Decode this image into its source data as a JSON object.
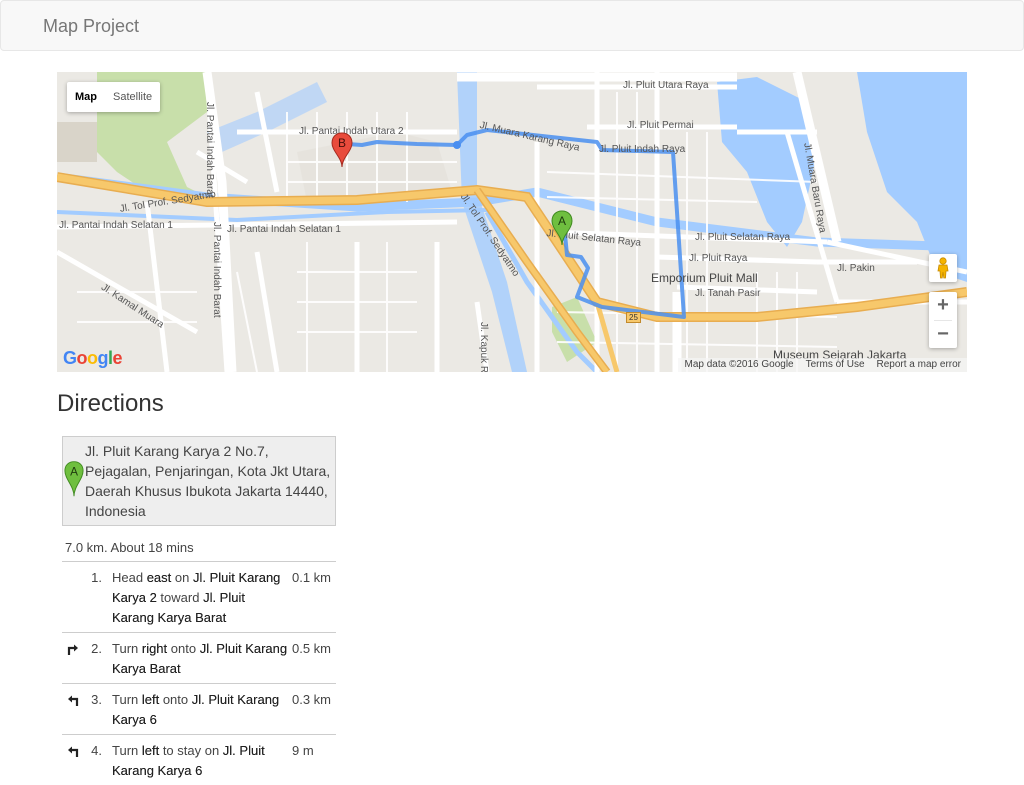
{
  "navbar": {
    "brand": "Map Project"
  },
  "map": {
    "type_control": {
      "map": "Map",
      "satellite": "Satellite"
    },
    "markers": {
      "a": "A",
      "b": "B"
    },
    "labels": {
      "pluit_utara": "Jl. Pluit Utara Raya",
      "pantai_indah_utara_2": "Jl. Pantai Indah Utara 2",
      "muara_karang": "Jl. Muara Karang Raya",
      "pluit_permai": "Jl. Pluit Permai",
      "pluit_indah": "Jl. Pluit Indah Raya",
      "tol_sedyatmo": "Jl. Tol Prof. Sedyatmo",
      "tol_sedyatmo_2": "Jl. Tol Prof. Sedyatmo",
      "pantai_indah_selatan": "Jl. Pantai Indah Selatan 1",
      "pantai_indah_selatan_2": "Jl. Pantai Indah Selatan 1",
      "pluit_selatan": "Jl. Pluit Selatan Raya",
      "pluit_selatan_2": "Jl. Pluit Selatan Raya",
      "pluit_raya": "Jl. Pluit Raya",
      "emporium": "Emporium Pluit Mall",
      "tanah_pasir": "Jl. Tanah Pasir",
      "pakin": "Jl. Pakin",
      "muara_baru": "Jl. Muara Baru Raya",
      "pantai_indah_barat": "Jl. Pantai Indah Barat",
      "pantai_indah_barat_2": "Jl. Pantai Indah Barat",
      "kamal_muara": "Jl. Kamal Muara",
      "kapuk": "Jl. Kapuk R",
      "museum": "Museum Sejarah Jakarta",
      "toll_25": "25"
    },
    "footer": {
      "data": "Map data ©2016 Google",
      "terms": "Terms of Use",
      "report": "Report a map error"
    },
    "logo": {
      "g1": "G",
      "o1": "o",
      "o2": "o",
      "g2": "g",
      "l": "l",
      "e": "e"
    },
    "zoom": {
      "in": "+",
      "out": "−"
    }
  },
  "directions": {
    "title": "Directions",
    "start_address": "Jl. Pluit Karang Karya 2 No.7, Pejagalan, Penjaringan, Kota Jkt Utara, Daerah Khusus Ibukota Jakarta 14440, Indonesia",
    "summary": "7.0 km. About 18 mins",
    "steps": [
      {
        "num": "1.",
        "icon": "none",
        "pre": "Head ",
        "b1": "east",
        "mid": " on ",
        "b2": "Jl. Pluit Karang Karya 2",
        "mid2": " toward ",
        "b3": "Jl. Pluit Karang Karya Barat",
        "dist": "0.1 km"
      },
      {
        "num": "2.",
        "icon": "turn-right-icon",
        "pre": "Turn ",
        "b1": "right",
        "mid": " onto ",
        "b2": "Jl. Pluit Karang Karya Barat",
        "mid2": "",
        "b3": "",
        "dist": "0.5 km"
      },
      {
        "num": "3.",
        "icon": "turn-left-icon",
        "pre": "Turn ",
        "b1": "left",
        "mid": " onto ",
        "b2": "Jl. Pluit Karang Karya 6",
        "mid2": "",
        "b3": "",
        "dist": "0.3 km"
      },
      {
        "num": "4.",
        "icon": "turn-left-icon",
        "pre": "Turn ",
        "b1": "left",
        "mid": " to stay on ",
        "b2": "Jl. Pluit Karang Karya 6",
        "mid2": "",
        "b3": "",
        "dist": "9 m"
      }
    ]
  },
  "colors": {
    "route": "#4a8ff0",
    "water": "#a3ccff",
    "highway": "#f7c86b",
    "marker_a": "#6fbf3f",
    "marker_b": "#e94b3c"
  }
}
